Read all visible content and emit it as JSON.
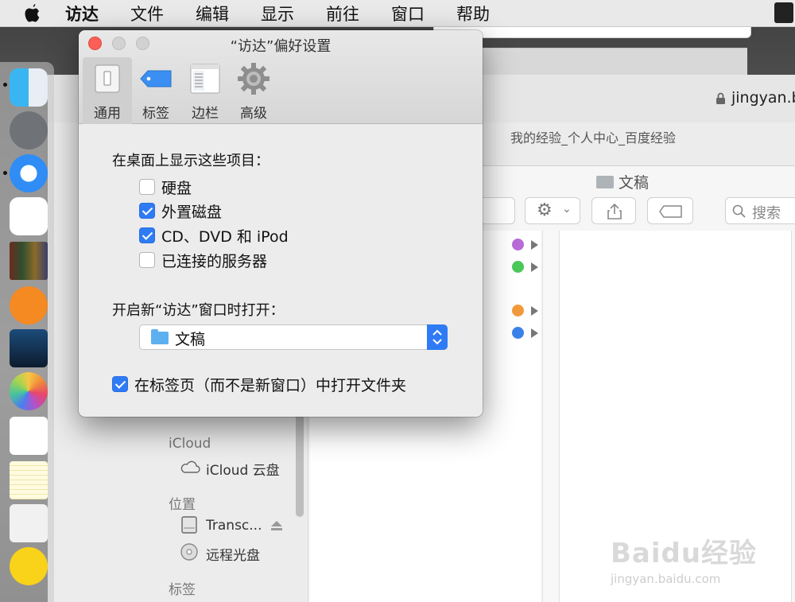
{
  "menubar": {
    "items": [
      "访达",
      "文件",
      "编辑",
      "显示",
      "前往",
      "窗口",
      "帮助"
    ]
  },
  "browser": {
    "url": "jingyan.b",
    "tab_title": "我的经验_个人中心_百度经验"
  },
  "finder": {
    "title": "文稿",
    "search_placeholder": "搜索",
    "sidebar": {
      "icloud_header": "iCloud",
      "icloud_drive": "iCloud 云盘",
      "locations_header": "位置",
      "location_items": [
        "Transc...",
        "远程光盘"
      ],
      "tags_header": "标签"
    },
    "tag_colors": [
      "#b86bd6",
      "#4cc75a",
      "#f29a3b",
      "#3b82e8"
    ]
  },
  "prefs": {
    "title": "“访达”偏好设置",
    "tabs": [
      "通用",
      "标签",
      "边栏",
      "高级"
    ],
    "selected_tab": "通用",
    "desktop_section_label": "在桌面上显示这些项目：",
    "desktop_items": [
      {
        "label": "硬盘",
        "checked": false
      },
      {
        "label": "外置磁盘",
        "checked": true
      },
      {
        "label": "CD、DVD 和 iPod",
        "checked": true
      },
      {
        "label": "已连接的服务器",
        "checked": false
      }
    ],
    "new_window_label": "开启新“访达”窗口时打开：",
    "new_window_value": "文稿",
    "open_in_tabs": {
      "label": "在标签页（而不是新窗口）中打开文件夹",
      "checked": true
    }
  },
  "watermark": {
    "main": "Baidu经验",
    "sub": "jingyan.baidu.com"
  },
  "colors": {
    "accent": "#2f7bf5",
    "close": "#fc5f57"
  }
}
